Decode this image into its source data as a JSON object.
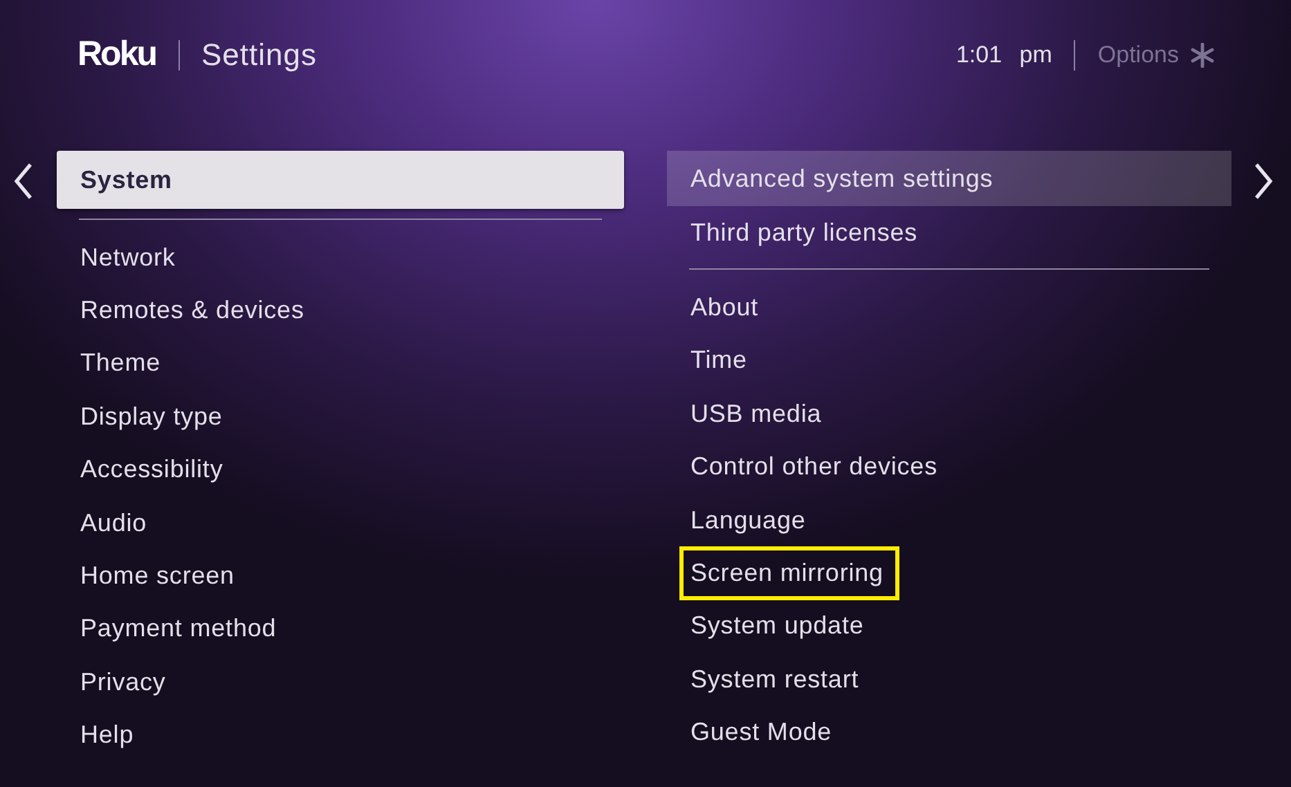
{
  "header": {
    "logo": "Roku",
    "title": "Settings",
    "time": "1:01 pm",
    "options": "Options"
  },
  "left_menu": {
    "groups": [
      [
        {
          "label": "System",
          "selected": true
        }
      ],
      [
        {
          "label": "Network",
          "selected": false
        },
        {
          "label": "Remotes & devices",
          "selected": false
        },
        {
          "label": "Theme",
          "selected": false
        },
        {
          "label": "Display type",
          "selected": false
        },
        {
          "label": "Accessibility",
          "selected": false
        },
        {
          "label": "Audio",
          "selected": false
        },
        {
          "label": "Home screen",
          "selected": false
        },
        {
          "label": "Payment method",
          "selected": false
        },
        {
          "label": "Privacy",
          "selected": false
        },
        {
          "label": "Help",
          "selected": false
        }
      ]
    ]
  },
  "right_menu": {
    "groups": [
      [
        {
          "label": "Advanced system settings",
          "selected": true,
          "highlighted": false
        },
        {
          "label": "Third party licenses",
          "selected": false,
          "highlighted": false
        }
      ],
      [
        {
          "label": "About",
          "selected": false,
          "highlighted": false
        },
        {
          "label": "Time",
          "selected": false,
          "highlighted": false
        },
        {
          "label": "USB media",
          "selected": false,
          "highlighted": false
        },
        {
          "label": "Control other devices",
          "selected": false,
          "highlighted": false
        },
        {
          "label": "Language",
          "selected": false,
          "highlighted": false
        },
        {
          "label": "Screen mirroring",
          "selected": false,
          "highlighted": true
        },
        {
          "label": "System update",
          "selected": false,
          "highlighted": false
        },
        {
          "label": "System restart",
          "selected": false,
          "highlighted": false
        },
        {
          "label": "Guest Mode",
          "selected": false,
          "highlighted": false
        }
      ]
    ]
  }
}
